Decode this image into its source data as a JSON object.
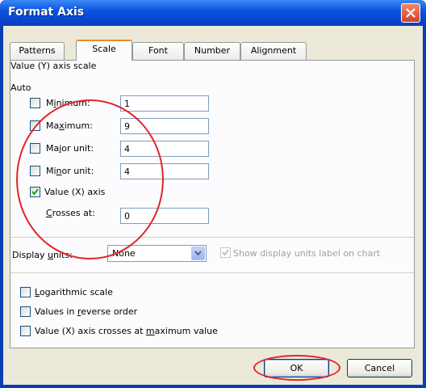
{
  "window": {
    "title": "Format Axis"
  },
  "tabs": [
    {
      "label": "Patterns",
      "active": false
    },
    {
      "label": "Scale",
      "active": true
    },
    {
      "label": "Font",
      "active": false
    },
    {
      "label": "Number",
      "active": false
    },
    {
      "label": "Alignment",
      "active": false
    }
  ],
  "scale": {
    "heading": "Value (Y) axis scale",
    "auto_label": "Auto",
    "minimum": {
      "label_pre": "M",
      "label_ul": "i",
      "label_post": "nimum:",
      "value": "1",
      "checked": false
    },
    "maximum": {
      "label_pre": "Ma",
      "label_ul": "x",
      "label_post": "imum:",
      "value": "9",
      "checked": false
    },
    "major_unit": {
      "label_pre": "Ma",
      "label_ul": "j",
      "label_post": "or unit:",
      "value": "4",
      "checked": false
    },
    "minor_unit": {
      "label_pre": "Mi",
      "label_ul": "n",
      "label_post": "or unit:",
      "value": "4",
      "checked": false
    },
    "value_x_axis": {
      "label": "Value (X) axis",
      "checked": true
    },
    "crosses_at": {
      "label_ul": "C",
      "label_post": "rosses at:",
      "value": "0"
    },
    "display_units": {
      "label_pre": "Display ",
      "label_ul": "u",
      "label_post": "nits:",
      "value": "None"
    },
    "show_units_label": {
      "label": "Show display units label on chart",
      "checked": true,
      "enabled": false
    },
    "logarithmic": {
      "label_pre": "",
      "label_ul": "L",
      "label_post": "ogarithmic scale",
      "checked": false
    },
    "reverse": {
      "label_pre": "Values in ",
      "label_ul": "r",
      "label_post": "everse order",
      "checked": false
    },
    "crosses_max": {
      "label_pre": "Value (X) axis crosses at ",
      "label_ul": "m",
      "label_post": "aximum value",
      "checked": false
    }
  },
  "buttons": {
    "ok": "OK",
    "cancel": "Cancel"
  },
  "colors": {
    "annotation": "#e0262b",
    "titlebar": "#0c55e0",
    "dialog_bg": "#ece9d8"
  }
}
